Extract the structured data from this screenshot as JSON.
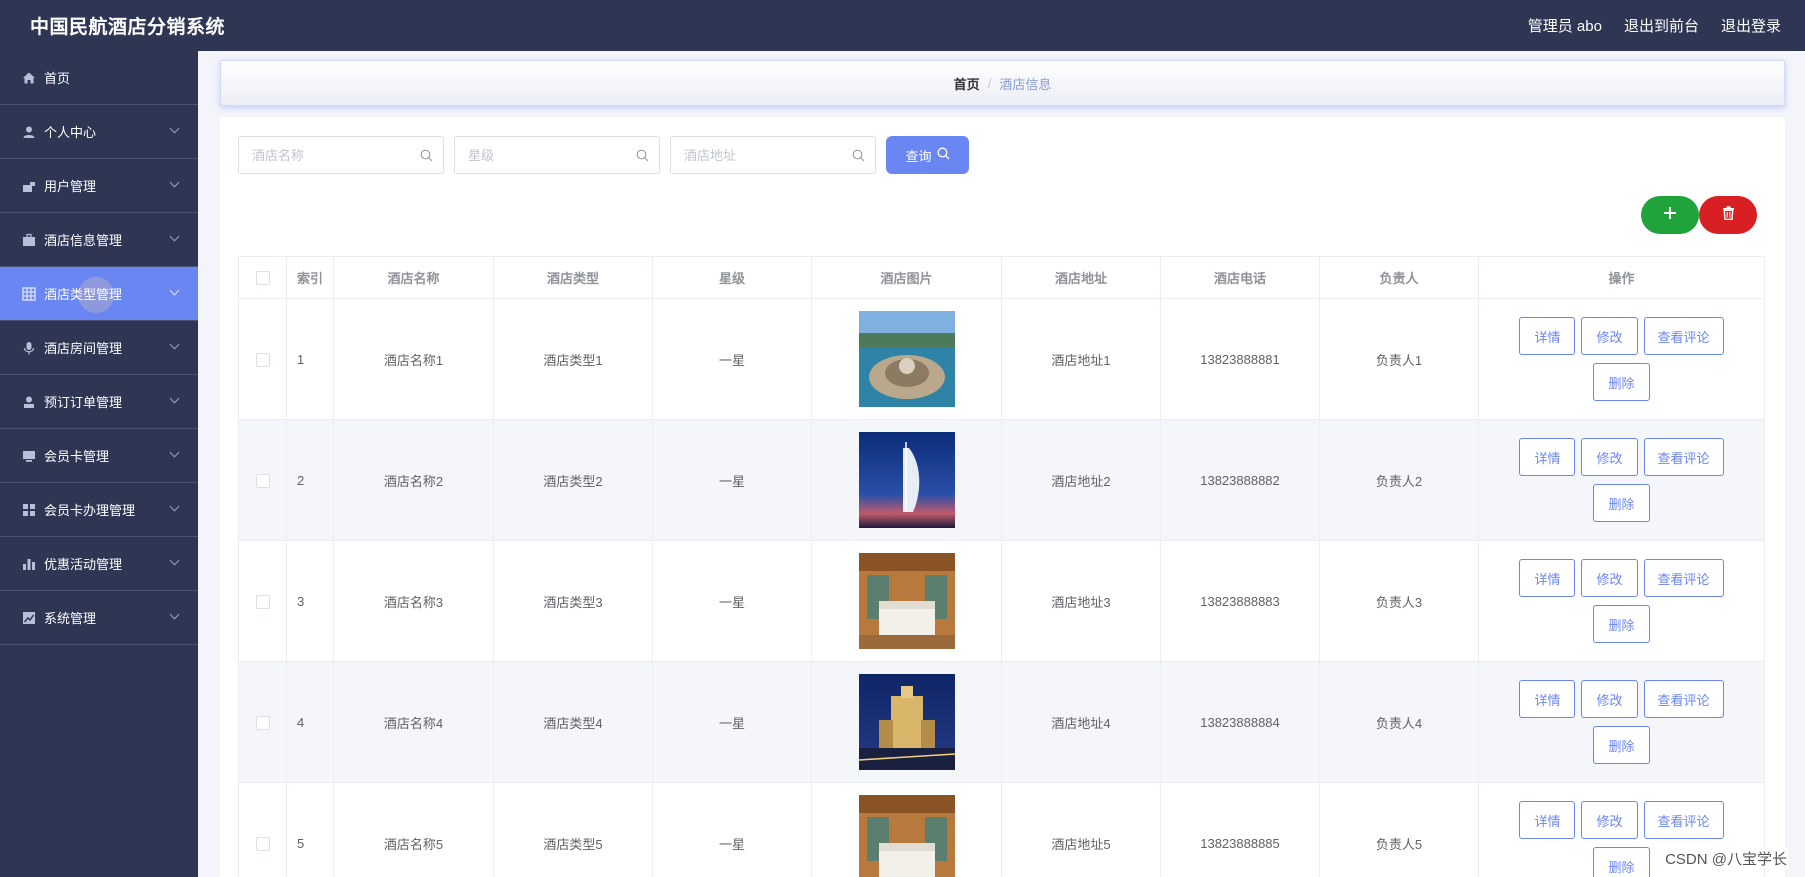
{
  "app": {
    "title": "中国民航酒店分销系统",
    "user": "管理员 abo",
    "to_front": "退出到前台",
    "logout": "退出登录"
  },
  "sidebar": {
    "items": [
      {
        "label": "首页",
        "icon": "home-icon",
        "has_arrow": false
      },
      {
        "label": "个人中心",
        "icon": "user-icon",
        "has_arrow": true
      },
      {
        "label": "用户管理",
        "icon": "user-manage-icon",
        "has_arrow": true
      },
      {
        "label": "酒店信息管理",
        "icon": "briefcase-icon",
        "has_arrow": true
      },
      {
        "label": "酒店类型管理",
        "icon": "grid-icon",
        "has_arrow": true,
        "active": true
      },
      {
        "label": "酒店房间管理",
        "icon": "mic-icon",
        "has_arrow": true
      },
      {
        "label": "预订订单管理",
        "icon": "person-icon",
        "has_arrow": true
      },
      {
        "label": "会员卡管理",
        "icon": "monitor-icon",
        "has_arrow": true
      },
      {
        "label": "会员卡办理管理",
        "icon": "apps-icon",
        "has_arrow": true
      },
      {
        "label": "优惠活动管理",
        "icon": "bar-chart-icon",
        "has_arrow": true
      },
      {
        "label": "系统管理",
        "icon": "trend-icon",
        "has_arrow": true
      }
    ]
  },
  "breadcrumb": {
    "home": "首页",
    "separator": "/",
    "current": "酒店信息"
  },
  "search": {
    "name_placeholder": "酒店名称",
    "star_placeholder": "星级",
    "address_placeholder": "酒店地址",
    "query_label": "查询"
  },
  "table": {
    "headers": [
      "索引",
      "酒店名称",
      "酒店类型",
      "星级",
      "酒店图片",
      "酒店地址",
      "酒店电话",
      "负责人",
      "操作"
    ],
    "rows": [
      {
        "index": "1",
        "name": "酒店名称1",
        "type": "酒店类型1",
        "star": "一星",
        "image": "resort-photo",
        "address": "酒店地址1",
        "phone": "13823888881",
        "manager": "负责人1"
      },
      {
        "index": "2",
        "name": "酒店名称2",
        "type": "酒店类型2",
        "star": "一星",
        "image": "tower-photo",
        "address": "酒店地址2",
        "phone": "13823888882",
        "manager": "负责人2"
      },
      {
        "index": "3",
        "name": "酒店名称3",
        "type": "酒店类型3",
        "star": "一星",
        "image": "room-photo",
        "address": "酒店地址3",
        "phone": "13823888883",
        "manager": "负责人3"
      },
      {
        "index": "4",
        "name": "酒店名称4",
        "type": "酒店类型4",
        "star": "一星",
        "image": "night-hotel-photo",
        "address": "酒店地址4",
        "phone": "13823888884",
        "manager": "负责人4"
      },
      {
        "index": "5",
        "name": "酒店名称5",
        "type": "酒店类型5",
        "star": "一星",
        "image": "room-photo",
        "address": "酒店地址5",
        "phone": "13823888885",
        "manager": "负责人5"
      }
    ],
    "actions": {
      "detail": "详情",
      "edit": "修改",
      "reviews": "查看评论",
      "delete": "删除"
    }
  },
  "watermark": "CSDN @八宝学长",
  "colors": {
    "nav_bg": "#2f3654",
    "accent": "#6a86f3",
    "add": "#1fa33a",
    "delete": "#d71f24"
  }
}
